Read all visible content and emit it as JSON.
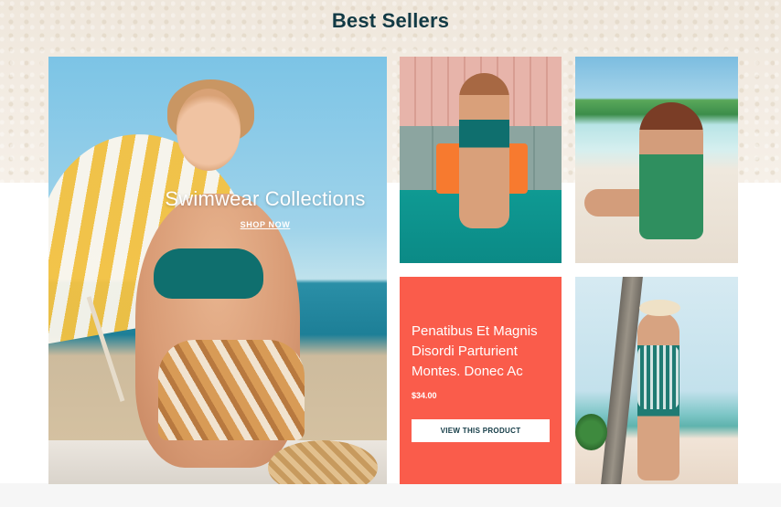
{
  "section": {
    "title": "Best Sellers"
  },
  "hero": {
    "title": "Swimwear Collections",
    "link_label": "SHOP NOW"
  },
  "product_card": {
    "name": "Penatibus Et Magnis Disordi Parturient Montes. Donec Ac",
    "price": "$34.00",
    "button_label": "VIEW THIS PRODUCT"
  },
  "colors": {
    "title": "#123a45",
    "card_background": "#fa5c4b",
    "card_button_text": "#123a45"
  }
}
